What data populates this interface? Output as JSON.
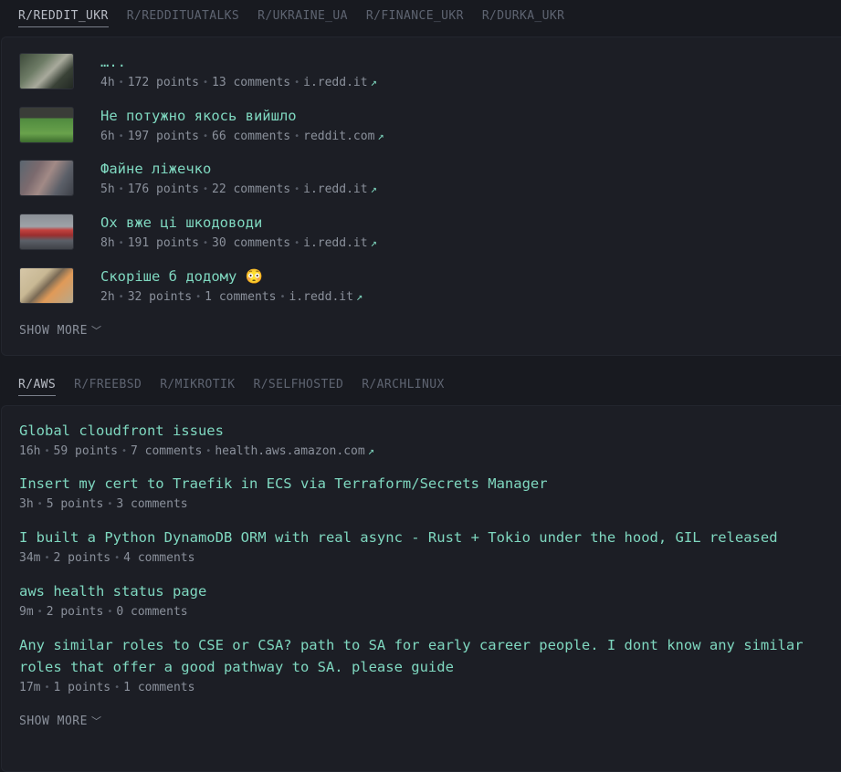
{
  "widget1": {
    "tabs": [
      "R/REDDIT_UKR",
      "R/REDDITUATALKS",
      "R/UKRAINE_UA",
      "R/FINANCE_UKR",
      "R/DURKA_UKR"
    ],
    "posts": [
      {
        "title": "…..",
        "age": "4h",
        "points": "172 points",
        "comments": "13 comments",
        "domain": "i.redd.it"
      },
      {
        "title": "Не потужно якось вийшло",
        "age": "6h",
        "points": "197 points",
        "comments": "66 comments",
        "domain": "reddit.com"
      },
      {
        "title": "Файне ліжечко",
        "age": "5h",
        "points": "176 points",
        "comments": "22 comments",
        "domain": "i.redd.it"
      },
      {
        "title": "Ох вже ці шкодоводи",
        "age": "8h",
        "points": "191 points",
        "comments": "30 comments",
        "domain": "i.redd.it"
      },
      {
        "title": "Скоріше б додому 😳",
        "age": "2h",
        "points": "32 points",
        "comments": "1 comments",
        "domain": "i.redd.it"
      }
    ],
    "show_more": "SHOW MORE"
  },
  "widget2": {
    "tabs": [
      "R/AWS",
      "R/FREEBSD",
      "R/MIKROTIK",
      "R/SELFHOSTED",
      "R/ARCHLINUX"
    ],
    "posts": [
      {
        "title": "Global cloudfront issues",
        "age": "16h",
        "points": "59 points",
        "comments": "7 comments",
        "domain": "health.aws.amazon.com"
      },
      {
        "title": "Insert my cert to Traefik in ECS via Terraform/Secrets Manager",
        "age": "3h",
        "points": "5 points",
        "comments": "3 comments",
        "domain": ""
      },
      {
        "title": "I built a Python DynamoDB ORM with real async - Rust + Tokio under the hood, GIL released",
        "age": "34m",
        "points": "2 points",
        "comments": "4 comments",
        "domain": ""
      },
      {
        "title": "aws health status page",
        "age": "9m",
        "points": "2 points",
        "comments": "0 comments",
        "domain": ""
      },
      {
        "title": "Any similar roles to CSE or CSA? path to SA for early career people. I dont know any similar roles that offer a good pathway to SA. please guide",
        "age": "17m",
        "points": "1 points",
        "comments": "1 comments",
        "domain": ""
      }
    ],
    "show_more": "SHOW MORE"
  },
  "icons": {
    "external_link": "↗",
    "chevron_down": "﹀"
  }
}
